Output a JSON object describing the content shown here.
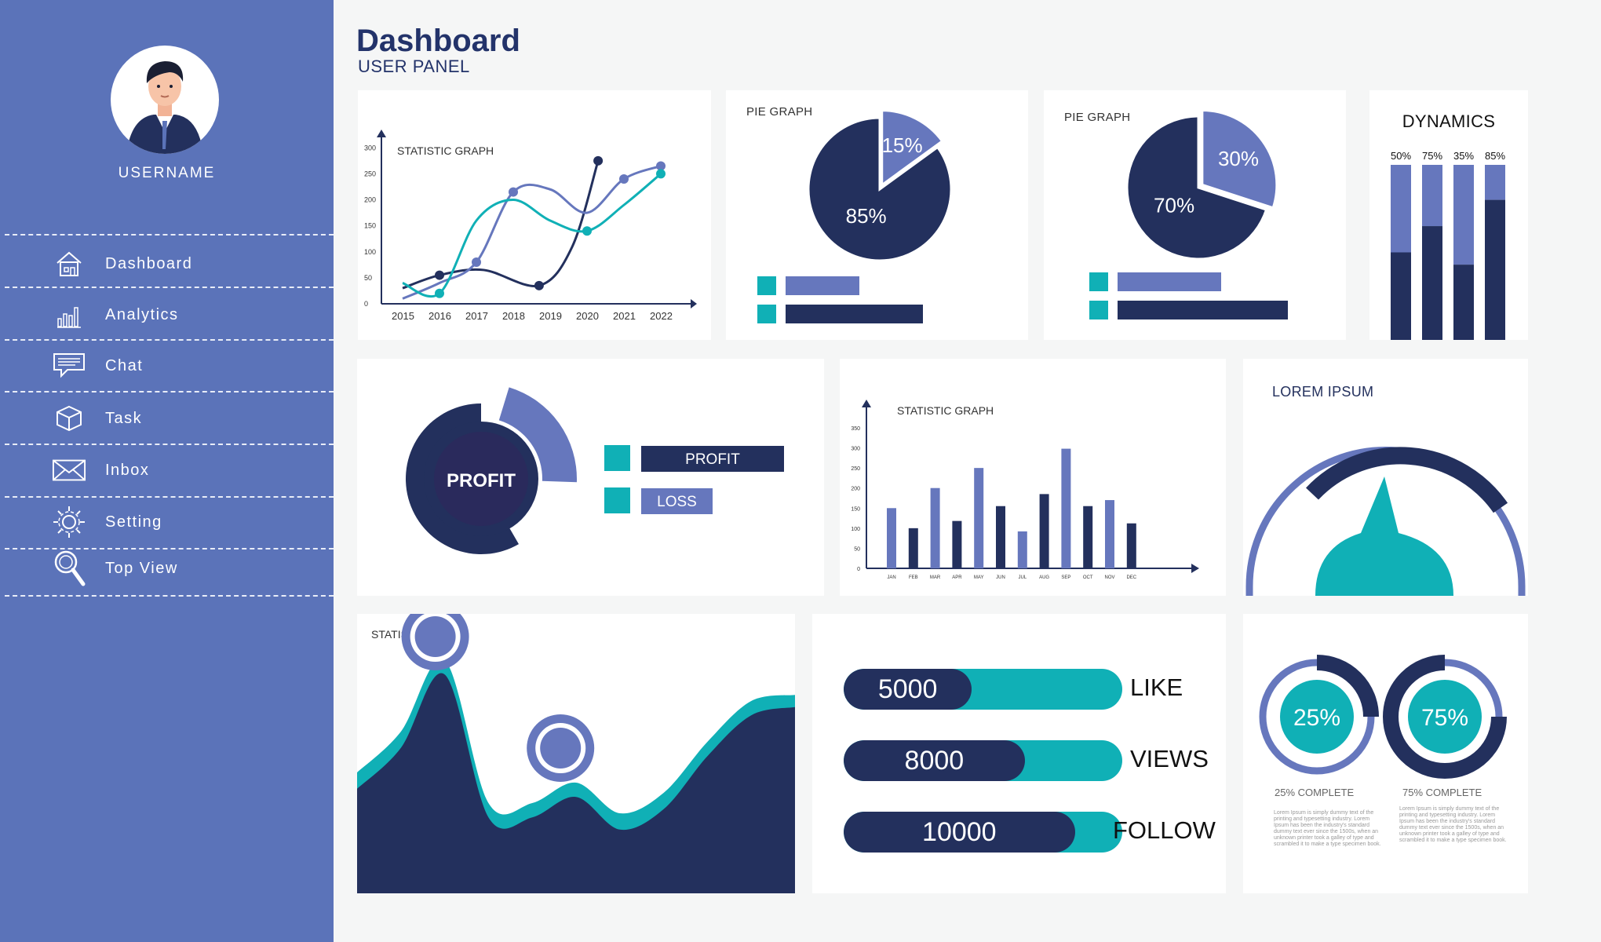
{
  "header": {
    "title": "Dashboard",
    "subtitle": "USER PANEL"
  },
  "sidebar": {
    "username": "USERNAME",
    "items": [
      {
        "label": "Dashboard",
        "icon": "home-icon"
      },
      {
        "label": "Analytics",
        "icon": "bar-chart-icon"
      },
      {
        "label": "Chat",
        "icon": "chat-icon"
      },
      {
        "label": "Task",
        "icon": "cube-icon"
      },
      {
        "label": "Inbox",
        "icon": "envelope-icon"
      },
      {
        "label": "Setting",
        "icon": "gear-icon"
      },
      {
        "label": "Top View",
        "icon": "magnifier-icon"
      }
    ]
  },
  "colors": {
    "sidebar": "#5b73b9",
    "navy": "#23305d",
    "teal": "#10b0b6",
    "periwinkle": "#6677bd",
    "background": "#f5f6f6"
  },
  "chart_data": [
    {
      "type": "line",
      "title": "STATISTIC GRAPH",
      "x": [
        "2015",
        "2016",
        "2017",
        "2018",
        "2019",
        "2020",
        "2021",
        "2022"
      ],
      "yticks": [
        0,
        50,
        100,
        150,
        200,
        250,
        300
      ],
      "ylim": [
        0,
        320
      ],
      "series": [
        {
          "color": "#23305d",
          "values": [
            30,
            55,
            65,
            35,
            110,
            275,
            null,
            null
          ],
          "x_index": [
            0,
            1,
            2.2,
            3.7,
            4.6,
            5.3
          ]
        },
        {
          "color": "#6677bd",
          "values": [
            10,
            40,
            80,
            215,
            220,
            175,
            240,
            265
          ]
        },
        {
          "color": "#10b0b6",
          "values": [
            40,
            20,
            160,
            200,
            160,
            140,
            190,
            250
          ]
        }
      ]
    },
    {
      "type": "pie",
      "title": "PIE GRAPH",
      "slices": [
        {
          "label": "15%",
          "value": 15,
          "color": "#6677bd"
        },
        {
          "label": "85%",
          "value": 85,
          "color": "#23305d"
        }
      ]
    },
    {
      "type": "pie",
      "title": "PIE GRAPH",
      "slices": [
        {
          "label": "30%",
          "value": 30,
          "color": "#6677bd"
        },
        {
          "label": "70%",
          "value": 70,
          "color": "#23305d"
        }
      ]
    },
    {
      "type": "bar",
      "title": "DYNAMICS",
      "categories": [
        "50%",
        "75%",
        "35%",
        "85%"
      ],
      "series": [
        {
          "values": [
            50,
            65,
            43,
            80
          ],
          "color": "#23305d"
        },
        {
          "values": [
            50,
            35,
            57,
            20
          ],
          "color": "#6677bd"
        }
      ],
      "ylim": [
        0,
        100
      ]
    },
    {
      "type": "bar",
      "title": "STATISTIC GRAPH",
      "categories": [
        "JAN",
        "FEB",
        "MAR",
        "APR",
        "MAY",
        "JUN",
        "JUL",
        "AUG",
        "SEP",
        "OCT",
        "NOV",
        "DEC"
      ],
      "values": [
        150,
        100,
        200,
        118,
        250,
        155,
        92,
        185,
        298,
        155,
        170,
        112
      ],
      "yticks": [
        0,
        50,
        100,
        150,
        200,
        250,
        300,
        350
      ],
      "ylim": [
        0,
        350
      ]
    },
    {
      "type": "area",
      "title": "STATISTIC GRAPH",
      "x": [
        0,
        1,
        2,
        3,
        4,
        5,
        6,
        7,
        8,
        9,
        10
      ],
      "series": [
        {
          "name": "",
          "color": "#10b0b6",
          "values": [
            40,
            60,
            95,
            25,
            25,
            35,
            20,
            30,
            55,
            75,
            78
          ]
        },
        {
          "name": "",
          "color": "#23305d",
          "values": [
            32,
            52,
            88,
            18,
            18,
            28,
            12,
            22,
            48,
            68,
            72
          ]
        }
      ]
    },
    {
      "type": "donut",
      "center_label": "PROFIT",
      "legend": [
        {
          "label": "PROFIT",
          "color": "#23305d"
        },
        {
          "label": "LOSS",
          "color": "#6677bd"
        }
      ]
    },
    {
      "type": "gauge",
      "title": "LOREM IPSUM"
    },
    {
      "type": "bar",
      "orientation": "horizontal",
      "items": [
        {
          "label": "LIKE",
          "value": 5000,
          "fraction": 0.46
        },
        {
          "label": "VIEWS",
          "value": 8000,
          "fraction": 0.65
        },
        {
          "label": "FOLLOW",
          "value": 10000,
          "fraction": 0.83
        }
      ]
    },
    {
      "type": "donut",
      "items": [
        {
          "label": "25%",
          "caption": "25% COMPLETE",
          "value": 25
        },
        {
          "label": "75%",
          "caption": "75% COMPLETE",
          "value": 75
        }
      ]
    }
  ],
  "lorem_text": "Lorem Ipsum is simply dummy text of the printing and typesetting industry. Lorem Ipsum has been the industry's standard dummy text ever since the 1500s, when an unknown printer took a galley of type and scrambled it to make a type specimen book."
}
